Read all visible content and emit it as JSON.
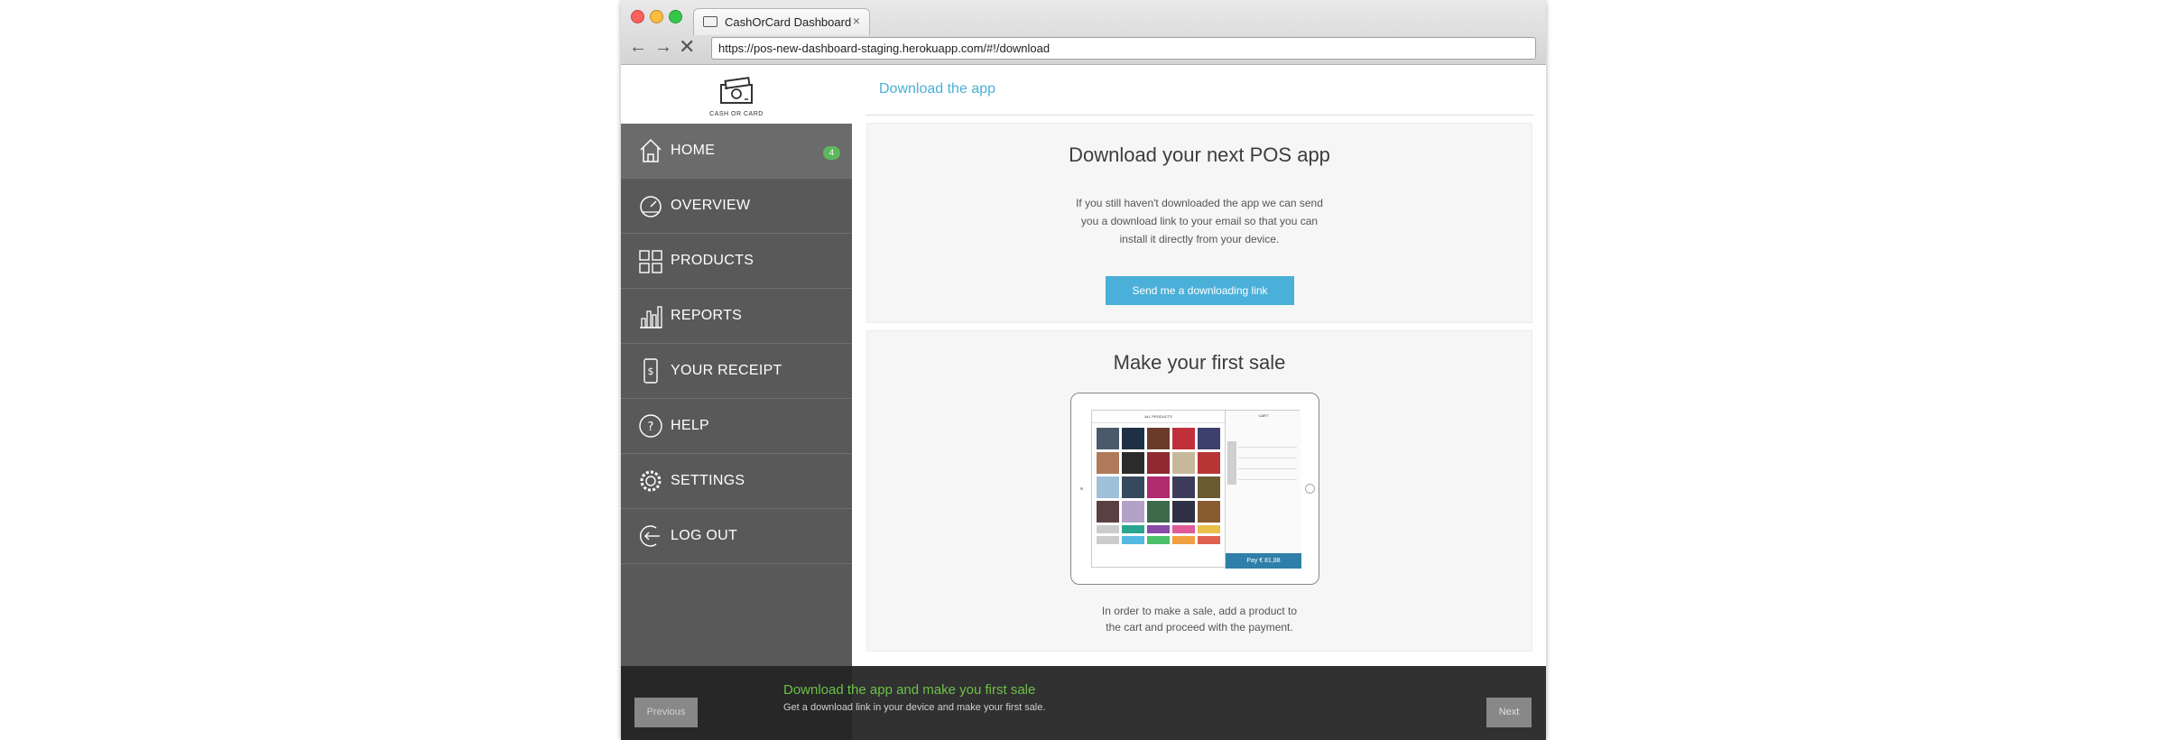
{
  "browser": {
    "tab_title": "CashOrCard Dashboard",
    "tab_close": "×",
    "url": "https://pos-new-dashboard-staging.herokuapp.com/#!/download",
    "back_glyph": "←",
    "forward_glyph": "→",
    "stop_glyph": "✕"
  },
  "brand": {
    "logo_text": "CASH OR CARD"
  },
  "sidebar": {
    "items": [
      {
        "label": "HOME",
        "icon": "home-icon",
        "badge": "4"
      },
      {
        "label": "OVERVIEW",
        "icon": "gauge-icon"
      },
      {
        "label": "PRODUCTS",
        "icon": "grid-icon"
      },
      {
        "label": "REPORTS",
        "icon": "bar-chart-icon"
      },
      {
        "label": "YOUR RECEIPT",
        "icon": "receipt-icon"
      },
      {
        "label": "HELP",
        "icon": "question-icon"
      },
      {
        "label": "SETTINGS",
        "icon": "gear-icon"
      },
      {
        "label": "LOG OUT",
        "icon": "logout-icon"
      }
    ]
  },
  "page": {
    "header_title": "Download the app",
    "download_card": {
      "title": "Download your next POS app",
      "text_lines": [
        "If you still haven't downloaded the app we can send",
        "you a download link to your email so that you can",
        "install it directly from your device."
      ],
      "button": "Send me a downloading link"
    },
    "sale_card": {
      "title": "Make your first sale",
      "text_lines": [
        "In order to make a sale, add a product to",
        "the cart and proceed with the payment."
      ],
      "ipad": {
        "grid_title": "ALL PRODUCTS",
        "cart_title": "CART",
        "pay_label": "Pay € 81,88"
      }
    }
  },
  "tour": {
    "title": "Download the app and make you first sale",
    "subtitle": "Get a download link in your device and make your first sale.",
    "prev_label": "Previous",
    "next_label": "Next"
  },
  "colors": {
    "accent": "#4ab0d9",
    "sidebar_bg": "#595959",
    "badge_green": "#5cb85c",
    "tour_title_green": "#6cc04a",
    "pay_blue": "#2f7fa8"
  }
}
